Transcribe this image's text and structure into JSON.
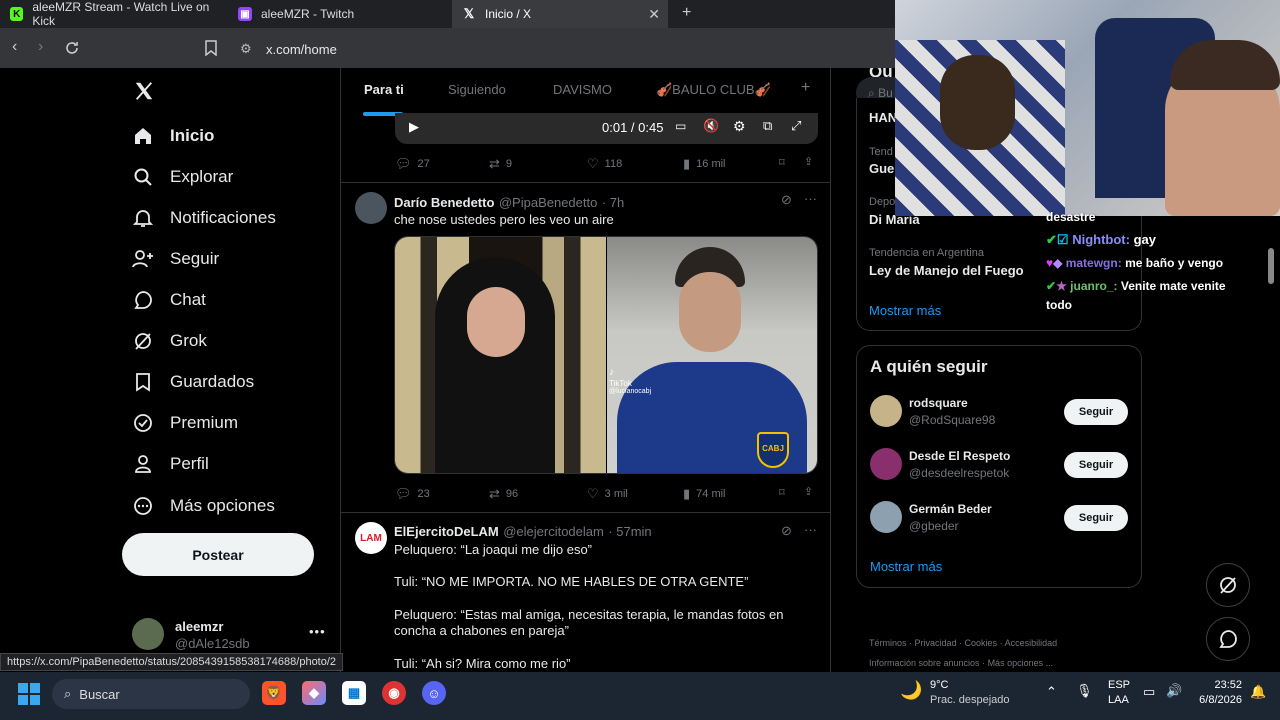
{
  "browser": {
    "tabs": [
      {
        "label": "aleeMZR Stream - Watch Live on Kick",
        "icon": "kick-icon",
        "color": "#53fc18"
      },
      {
        "label": "aleeMZR - Twitch",
        "icon": "twitch-icon",
        "color": "#9146ff"
      },
      {
        "label": "Inicio / X",
        "icon": "x-icon",
        "active": true
      }
    ],
    "url": "x.com/home",
    "status_url": "https://x.com/PipaBenedetto/status/2085439158538174688/photo/2"
  },
  "sidebar": {
    "items": [
      {
        "label": "Inicio",
        "icon": "home-icon",
        "active": true
      },
      {
        "label": "Explorar",
        "icon": "search-icon"
      },
      {
        "label": "Notificaciones",
        "icon": "bell-icon"
      },
      {
        "label": "Seguir",
        "icon": "follow-icon"
      },
      {
        "label": "Chat",
        "icon": "chat-icon"
      },
      {
        "label": "Grok",
        "icon": "grok-icon"
      },
      {
        "label": "Guardados",
        "icon": "bookmark-icon"
      },
      {
        "label": "Premium",
        "icon": "premium-icon"
      },
      {
        "label": "Perfil",
        "icon": "profile-icon"
      },
      {
        "label": "Más opciones",
        "icon": "more-icon"
      }
    ],
    "post_button": "Postear",
    "account": {
      "name": "aleemzr",
      "handle": "@dAle12sdb"
    }
  },
  "feed": {
    "tabs": [
      "Para ti",
      "Siguiendo",
      "DAVISMO",
      "🎻BAULO CLUB🎻"
    ],
    "add_tab": "+",
    "video_time": "0:01 / 0:45",
    "tweets": [
      {
        "actions": {
          "replies": "27",
          "retweets": "9",
          "likes": "118",
          "views": "16 mil"
        }
      },
      {
        "name": "Darío Benedetto",
        "handle": "@PipaBenedetto",
        "time": "· 7h",
        "text": "che nose ustedes pero les veo un aire",
        "tiktok_label": "TikTok",
        "tiktok_user": "@lucianocabj",
        "actions": {
          "replies": "23",
          "retweets": "96",
          "likes": "3 mil",
          "views": "74 mil"
        }
      },
      {
        "name": "ElEjercitoDeLAM",
        "handle": "@elejercitodelam",
        "time": "· 57min",
        "avatar_text": "LAM",
        "lines": [
          "Peluquero: “La joaqui me dijo eso”",
          "Tuli: “NO ME IMPORTA. NO ME HABLES DE OTRA GENTE”",
          "Peluquero: “Estas mal amiga, necesitas terapia, le mandas fotos en concha a chabones en pareja”",
          "Tuli: “Ah si? Mira como me rio”"
        ]
      }
    ]
  },
  "right": {
    "search_placeholder": "Bu",
    "trends_header": "Qu",
    "trends": [
      {
        "category": "",
        "name": "HAN"
      },
      {
        "category": "Tend",
        "name": "Gue"
      },
      {
        "category": "Depo",
        "name": "Di María"
      },
      {
        "category": "Tendencia en Argentina",
        "name": "Ley de Manejo del Fuego"
      }
    ],
    "show_more": "Mostrar más",
    "who_to_follow": {
      "title": "A quién seguir",
      "users": [
        {
          "name": "rodsquare",
          "handle": "@RodSquare98",
          "button": "Seguir"
        },
        {
          "name": "Desde El Respeto",
          "handle": "@desdeelrespetok",
          "button": "Seguir"
        },
        {
          "name": "Germán Beder",
          "handle": "@gbeder",
          "button": "Seguir"
        }
      ],
      "show_more": "Mostrar más"
    },
    "footer": [
      "Términos",
      "Privacidad",
      "Cookies",
      "Accesibilidad",
      "Información sobre anuncios",
      "Más opciones ..."
    ]
  },
  "stream_chat": [
    {
      "user": "",
      "text": "desastre",
      "color": "#ffffff"
    },
    {
      "user": "Nightbot:",
      "text": "gay",
      "color": "#8a8cff"
    },
    {
      "user": "matewgn:",
      "text": "me baño y vengo",
      "color": "#8a6fe0"
    },
    {
      "user": "juanro_:",
      "text": "Venite mate venite",
      "color": "#6fbf6f"
    },
    {
      "user": "",
      "text": "todo",
      "color": "#ffffff"
    }
  ],
  "taskbar": {
    "search": "Buscar",
    "weather_temp": "9°C",
    "weather_desc": "Prac. despejado",
    "lang_top": "ESP",
    "lang_bottom": "LAA",
    "time": "23:52",
    "date": "6/8/2026"
  }
}
